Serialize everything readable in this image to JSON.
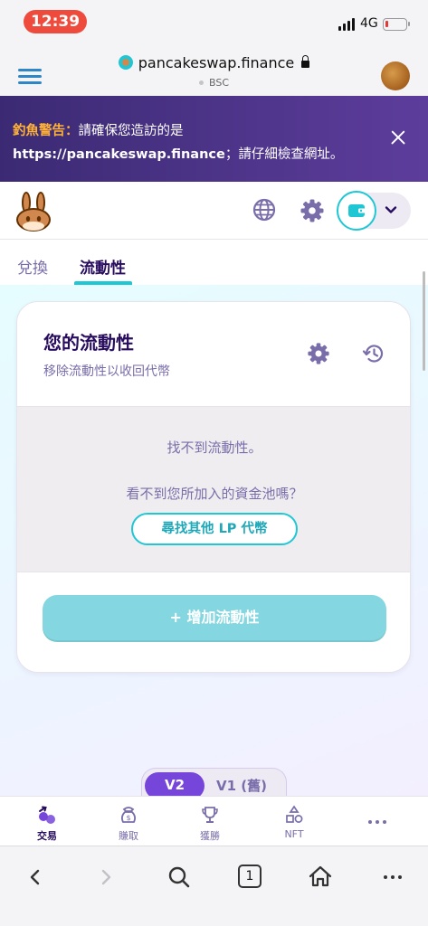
{
  "status_bar": {
    "time": "12:39",
    "network": "4G",
    "battery_level": 0.15
  },
  "browser": {
    "domain": "pancakeswap.finance",
    "network_label": "BSC"
  },
  "warning": {
    "label": "釣魚警告：",
    "text_line1": "請確保您造訪的是",
    "url": "https://pancakeswap.finance",
    "text_line2": "；請仔細檢查網址。"
  },
  "tabs": [
    {
      "label": "兌換",
      "active": false
    },
    {
      "label": "流動性",
      "active": true
    }
  ],
  "card": {
    "title": "您的流動性",
    "subtitle": "移除流動性以收回代幣",
    "empty_message": "找不到流動性。",
    "pool_question": "看不到您所加入的資金池嗎？",
    "find_lp_label": "尋找其他 LP 代幣",
    "add_liquidity_label": "+ 增加流動性"
  },
  "version_toggle": {
    "v2_label": "V2",
    "v1_label": "V1 (舊)"
  },
  "bottom_nav": [
    {
      "label": "交易",
      "icon": "trade-icon",
      "active": true
    },
    {
      "label": "賺取",
      "icon": "earn-icon",
      "active": false
    },
    {
      "label": "獲勝",
      "icon": "trophy-icon",
      "active": false
    },
    {
      "label": "NFT",
      "icon": "nft-icon",
      "active": false
    },
    {
      "label": "",
      "icon": "more-icon",
      "active": false
    }
  ],
  "safari": {
    "tab_count": "1"
  },
  "colors": {
    "primary": "#1fc7d4",
    "secondary": "#7645d9",
    "text": "#280d5f",
    "text_subtle": "#7a6eaa",
    "warning_bg": "#3b2a73",
    "warning_label": "#ffb237"
  }
}
